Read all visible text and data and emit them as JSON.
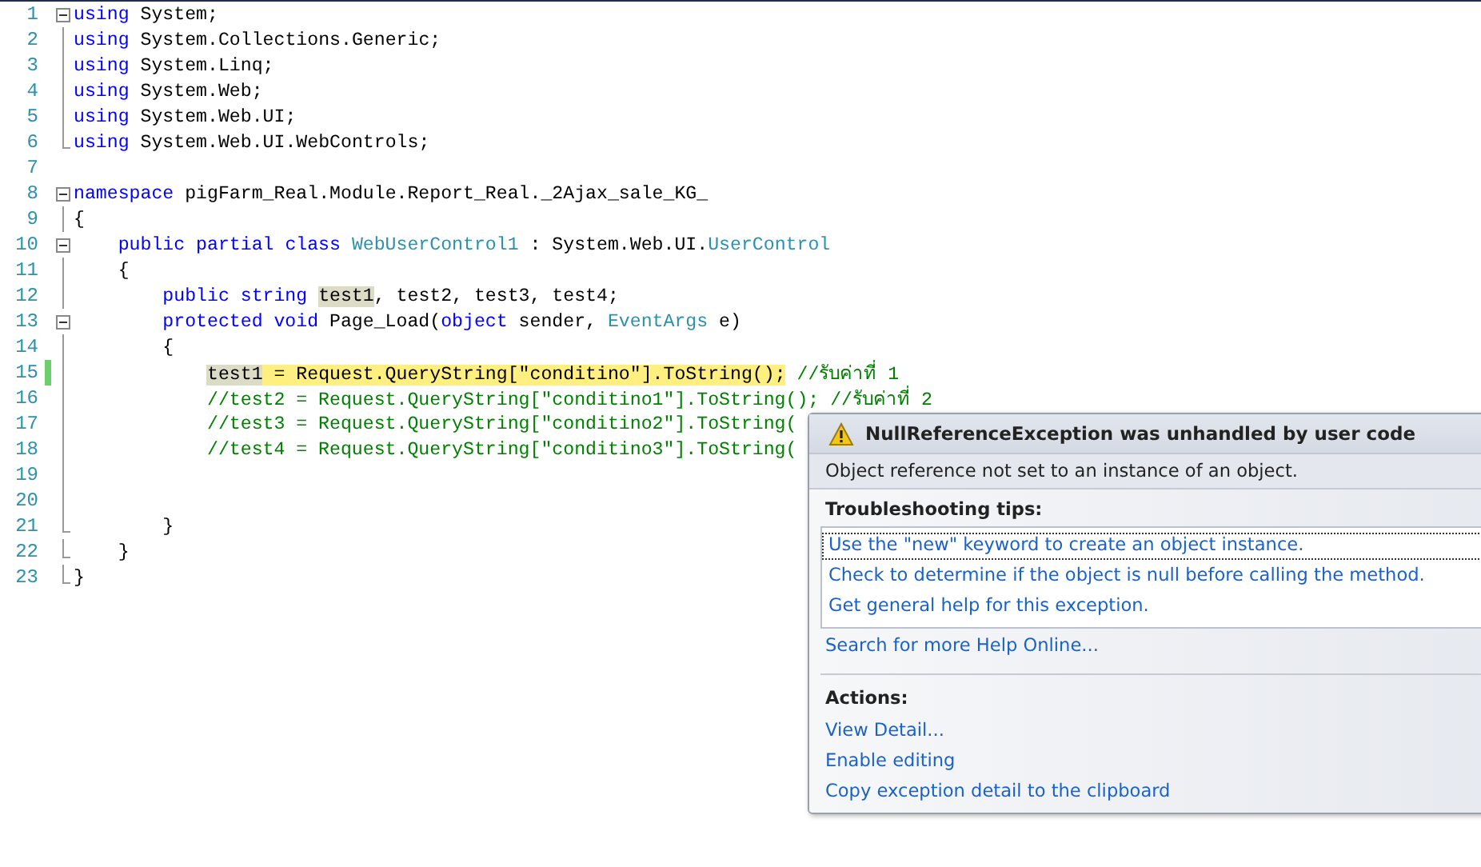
{
  "editor": {
    "lines": [
      {
        "number": "1",
        "kind": "fold-start",
        "changed": false,
        "tokens": [
          {
            "kind": "keyword",
            "text": "using"
          },
          {
            "kind": "plain",
            "text": " System;"
          }
        ]
      },
      {
        "number": "2",
        "kind": "fold-line",
        "changed": false,
        "tokens": [
          {
            "kind": "keyword",
            "text": "using"
          },
          {
            "kind": "plain",
            "text": " System.Collections.Generic;"
          }
        ]
      },
      {
        "number": "3",
        "kind": "fold-line",
        "changed": false,
        "tokens": [
          {
            "kind": "keyword",
            "text": "using"
          },
          {
            "kind": "plain",
            "text": " System.Linq;"
          }
        ]
      },
      {
        "number": "4",
        "kind": "fold-line",
        "changed": false,
        "tokens": [
          {
            "kind": "keyword",
            "text": "using"
          },
          {
            "kind": "plain",
            "text": " System.Web;"
          }
        ]
      },
      {
        "number": "5",
        "kind": "fold-line",
        "changed": false,
        "tokens": [
          {
            "kind": "keyword",
            "text": "using"
          },
          {
            "kind": "plain",
            "text": " System.Web.UI;"
          }
        ]
      },
      {
        "number": "6",
        "kind": "fold-end",
        "changed": false,
        "tokens": [
          {
            "kind": "keyword",
            "text": "using"
          },
          {
            "kind": "plain",
            "text": " System.Web.UI.WebControls;"
          }
        ]
      },
      {
        "number": "7",
        "kind": "plain",
        "changed": false
      },
      {
        "number": "8",
        "kind": "fold-start",
        "changed": false,
        "tokens": [
          {
            "kind": "keyword",
            "text": "namespace"
          },
          {
            "kind": "plain",
            "text": " pigFarm_Real.Module.Report_Real._2Ajax_sale_KG_"
          }
        ]
      },
      {
        "number": "9",
        "kind": "fold-line",
        "changed": false,
        "tokens": [
          {
            "kind": "plain",
            "text": "{"
          }
        ],
        "children": [
          {
            "number": "10",
            "kind": "fold-start",
            "changed": false,
            "tokens": [
              {
                "kind": "keyword",
                "text": "public partial class "
              },
              {
                "kind": "type",
                "text": "WebUserControl1"
              },
              {
                "kind": "plain",
                "text": " : System.Web.UI."
              },
              {
                "kind": "type",
                "text": "UserControl"
              }
            ]
          },
          {
            "number": "11",
            "kind": "fold-line",
            "changed": false,
            "tokens": [
              {
                "kind": "plain",
                "text": "{"
              }
            ],
            "children": [
              {
                "number": "12",
                "kind": "fold-line",
                "changed": false,
                "tokens": [
                  {
                    "kind": "keyword",
                    "text": "public string "
                  },
                  {
                    "kind": "reference",
                    "text": "test1"
                  },
                  {
                    "kind": "plain",
                    "text": ", test2, test3, test4;"
                  }
                ]
              },
              {
                "number": "13",
                "kind": "fold-start",
                "changed": false,
                "tokens": [
                  {
                    "kind": "keyword",
                    "text": "protected void"
                  },
                  {
                    "kind": "plain",
                    "text": " Page_Load("
                  },
                  {
                    "kind": "keyword",
                    "text": "object"
                  },
                  {
                    "kind": "plain",
                    "text": " sender, "
                  },
                  {
                    "kind": "type",
                    "text": "EventArgs"
                  },
                  {
                    "kind": "plain",
                    "text": " e)"
                  }
                ]
              },
              {
                "number": "14",
                "kind": "fold-line",
                "changed": false,
                "tokens": [
                  {
                    "kind": "plain",
                    "text": "{"
                  }
                ],
                "children": [
                  {
                    "number": "15",
                    "kind": "fold-line",
                    "changed": true,
                    "tokens": [
                      {
                        "kind": "reference",
                        "text": "test1"
                      },
                      {
                        "kind": "statement",
                        "text": " = Request.QueryString[\"conditino\"].ToString();"
                      },
                      {
                        "kind": "comment",
                        "text": " //รับค่าที่ 1"
                      }
                    ]
                  },
                  {
                    "number": "16",
                    "kind": "fold-line",
                    "changed": false,
                    "tokens": [
                      {
                        "kind": "comment",
                        "text": "//test2 = Request.QueryString[\"conditino1\"].ToString(); //รับค่าที่ 2"
                      }
                    ]
                  },
                  {
                    "number": "17",
                    "kind": "fold-line",
                    "changed": false,
                    "tokens": [
                      {
                        "kind": "comment",
                        "text": "//test3 = Request.QueryString[\"conditino2\"].ToString("
                      }
                    ]
                  },
                  {
                    "number": "18",
                    "kind": "fold-line",
                    "changed": false,
                    "tokens": [
                      {
                        "kind": "comment",
                        "text": "//test4 = Request.QueryString[\"conditino3\"].ToString("
                      }
                    ]
                  },
                  {
                    "number": "19",
                    "kind": "fold-line",
                    "changed": false
                  },
                  {
                    "number": "20",
                    "kind": "fold-line",
                    "changed": false
                  }
                ]
              },
              {
                "number": "21",
                "kind": "fold-end",
                "changed": false,
                "tokens": [
                  {
                    "kind": "plain",
                    "text": "}"
                  }
                ]
              }
            ]
          },
          {
            "number": "22",
            "kind": "fold-end",
            "changed": false,
            "tokens": [
              {
                "kind": "plain",
                "text": "}"
              }
            ]
          }
        ]
      },
      {
        "number": "23",
        "kind": "fold-end",
        "changed": false,
        "tokens": [
          {
            "kind": "plain",
            "text": "}"
          }
        ]
      }
    ]
  },
  "exception_popup": {
    "title": "NullReferenceException was unhandled by user code",
    "message": "Object reference not set to an instance of an object.",
    "tips_heading": "Troubleshooting tips:",
    "tips": [
      {
        "text": "Use the \"new\" keyword to create an object instance.",
        "selected": true
      },
      {
        "text": "Check to determine if the object is null before calling the method.",
        "selected": false
      },
      {
        "text": "Get general help for this exception.",
        "selected": false
      }
    ],
    "search_link": "Search for more Help Online...",
    "actions_heading": "Actions:",
    "actions": [
      "View Detail...",
      "Enable editing",
      "Copy exception detail to the clipboard"
    ]
  }
}
